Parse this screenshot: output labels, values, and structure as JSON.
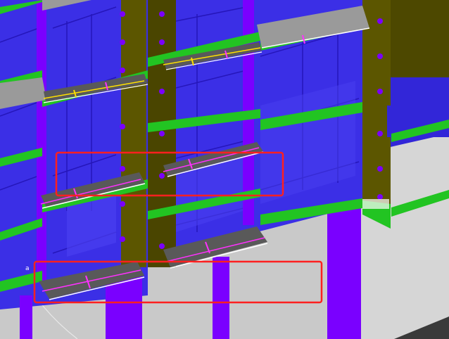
{
  "viewport": {
    "type": "3d-model-view",
    "stray_glyph": "a"
  },
  "colors": {
    "background": "#c9c9c9",
    "glass": "#3b2fe6",
    "glass_dark": "#2a1fc0",
    "column": "#7a00ff",
    "timber": "#5c5600",
    "timber_dark": "#3f3a00",
    "slab_green": "#22c422",
    "ledge_gray": "#595959",
    "ledge_light": "#9a9a9a",
    "magenta": "#ff30ff",
    "yellow": "#ffe000",
    "highlight_red": "#ff2020"
  },
  "highlights": [
    {
      "id": "upper-selection",
      "color": "#ff2020"
    },
    {
      "id": "lower-selection",
      "color": "#ff2020"
    }
  ]
}
